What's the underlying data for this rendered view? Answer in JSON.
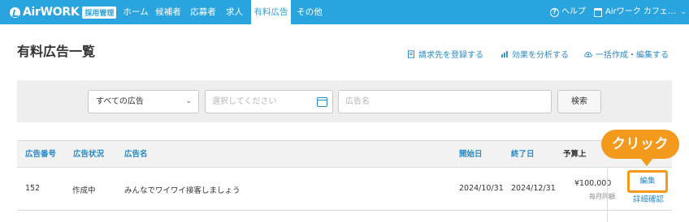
{
  "header": {
    "logo_text": "AirWORK",
    "logo_badge": "採用管理",
    "nav": [
      "ホーム",
      "候補者",
      "応募者",
      "求人",
      "有料広告",
      "その他"
    ],
    "help_label": "ヘルプ",
    "account_label": "Airワーク カフェ…"
  },
  "page": {
    "title": "有料広告一覧",
    "actions": {
      "register_billing": "請求先を登録する",
      "analyze": "効果を分析する",
      "bulk": "一括作成・編集する"
    }
  },
  "search": {
    "type_selected": "すべての広告",
    "date_placeholder": "選択してください",
    "name_placeholder": "広告名",
    "button": "検索"
  },
  "table": {
    "headers": {
      "ad_no": "広告番号",
      "status": "広告状況",
      "name": "広告名",
      "start": "開始日",
      "end": "終了日",
      "budget": "予算上"
    },
    "rows": [
      {
        "ad_no": "152",
        "status": "作成中",
        "name": "みんなでワイワイ接客しましょう",
        "start": "2024/10/31",
        "end": "2024/12/31",
        "budget": "¥100,000",
        "budget_note": "毎月同額",
        "edit": "編集",
        "detail": "詳細確認"
      }
    ]
  },
  "callout": {
    "text": "クリック",
    "color": "#f39a1c"
  },
  "colors": {
    "nav_bg": "#2aa4de",
    "link": "#2a8ac7"
  }
}
